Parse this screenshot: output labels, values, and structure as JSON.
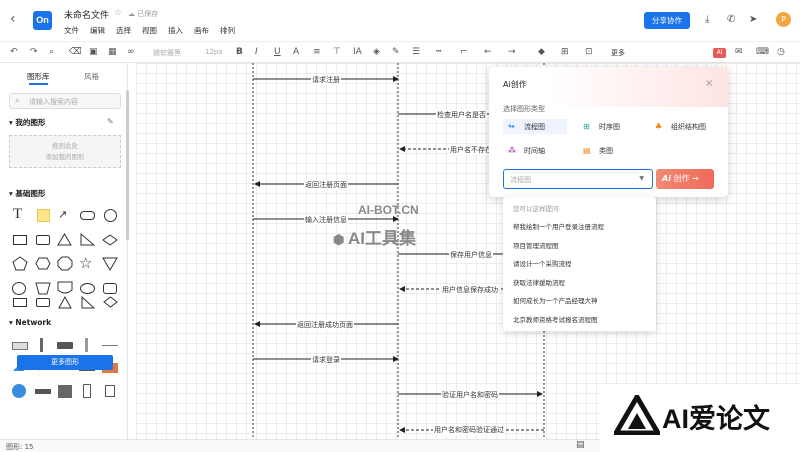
{
  "app": {
    "logo_text": "On",
    "title": "未命名文件",
    "saved_status": "已保存",
    "menu": [
      "文件",
      "编辑",
      "选择",
      "视图",
      "插入",
      "画布",
      "排列"
    ],
    "share_label": "分享协作",
    "avatar": "P",
    "accent": "#1a73e8"
  },
  "toolbar": {
    "font_name": "微软雅黑",
    "font_size": "12px",
    "more_label": "更多"
  },
  "sidebar": {
    "tabs": [
      "图形库",
      "风格"
    ],
    "search_placeholder": "请输入搜索内容",
    "my_shapes_title": "我的图形",
    "drop_text_1": "拖到此处",
    "drop_text_2": "添加我的图形",
    "basic_title": "基础图形",
    "network_title": "Network",
    "more_button": "更多图形"
  },
  "canvas": {
    "messages": [
      "请求注册",
      "检查用户名是否",
      "用户名不存在",
      "返回注册页面",
      "输入注册信息",
      "保存用户信息",
      "用户信息保存成功",
      "返回注册成功页面",
      "请求登录",
      "验证用户名和密码",
      "用户名和密码验证通过"
    ]
  },
  "ai_popup": {
    "title": "Ai创作",
    "subtitle": "选择图形类型",
    "options": [
      {
        "label": "流程图",
        "icon": "flowchart-icon",
        "color": "#1a73e8"
      },
      {
        "label": "时序图",
        "icon": "sequence-icon",
        "color": "#26a69a"
      },
      {
        "label": "组织结构图",
        "icon": "org-chart-icon",
        "color": "#f57c00"
      },
      {
        "label": "时间轴",
        "icon": "timeline-icon",
        "color": "#8e24aa"
      },
      {
        "label": "类图",
        "icon": "class-diagram-icon",
        "color": "#f57c00"
      }
    ],
    "input_value": "流程图",
    "create_label": "创作"
  },
  "suggestions": {
    "hint": "您可以这样提问:",
    "items": [
      "帮我绘制一个用户登录注册流程",
      "项目管理流程图",
      "请设计一个采购流程",
      "获取法律援助流程",
      "如何成长为一个产品经理大神",
      "北京教师资格考试报名流程图"
    ]
  },
  "status": {
    "shape_count_label": "图形: 15"
  },
  "watermarks": {
    "top": "AI-BOT.CN",
    "middle": "AI工具集",
    "corner": "AI爱论文"
  }
}
